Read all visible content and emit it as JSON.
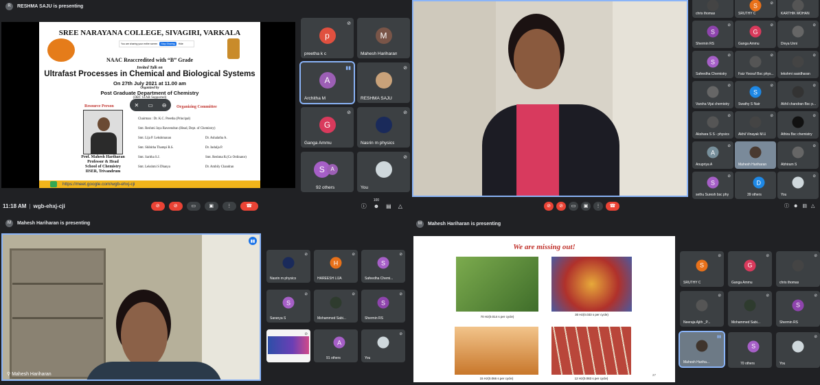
{
  "q1": {
    "presenting": "RESHMA SAJU is presenting",
    "presenter_initial": "R",
    "slide": {
      "college": "SREE NARAYANA COLLEGE, SIVAGIRI, VARKALA",
      "share_notice": "You are sharing your entire screen",
      "share_btn": "Stop Sharing",
      "hide_btn": "Hide",
      "naac": "NAAC Reaccredited with “B” Grade",
      "invited": "Invited Talk on",
      "title": "Ultrafast Processes in Chemical and Biological Systems",
      "date": "On 27th July 2021 at 11.00 am",
      "organized": "Organized by",
      "dept": "Post Graduate Department of Chemistry",
      "star": "(DBT STAR Supported)",
      "resource": "Resource Person",
      "organizing": "Organizing Committee",
      "members": [
        "Chairman : Dr. K.C. Preetha (Principal)",
        "Smt. Reshmi Jaya Raveendran (Head, Dept. of Chemistry)",
        "Smt. Lija P. Lekshmanan",
        "Dr. Ashalatha A.",
        "Smt. Shibitha Thampi R.S.",
        "Dr. Indulja P.",
        "Smt. Saritha S.J.",
        "Smt. Reshma R.(Co Ordinator)",
        "Smt. Lekshmi S Dhanya",
        "Dr. Ambily Chandran"
      ],
      "speaker": [
        "Prof. Mahesh Hariharan",
        "Professor & Head",
        "School of Chemistry",
        "IISER, Trivandrum"
      ],
      "link": "https://meet.google.com/wgb-ehxj-cji"
    },
    "tiles": [
      {
        "name": "preetha k c",
        "initial": "p",
        "color": "#e0503f"
      },
      {
        "name": "Mahesh Hariharan",
        "initial": "M",
        "color": "#795548"
      },
      {
        "name": "Architha M",
        "initial": "A",
        "color": "#9c5fb5"
      },
      {
        "name": "RESHMA SAJU",
        "initial": "",
        "color": "#c9a27a"
      },
      {
        "name": "Ganga Ammu",
        "initial": "G",
        "color": "#d93a5c"
      },
      {
        "name": "Nasrin m physics",
        "initial": "",
        "color": "#1a2a5a"
      },
      {
        "name": "92 others",
        "initial": "S",
        "color": "#a65fc7"
      },
      {
        "name": "You",
        "initial": "",
        "color": "#cfd8dc"
      }
    ],
    "time": "11:18 AM",
    "meeting_code": "wgb-ehxj-cji",
    "participants_count": "100"
  },
  "q2": {
    "tiles": [
      {
        "name": "chris thomas",
        "initial": "",
        "color": "#444"
      },
      {
        "name": "SRUTHY C",
        "initial": "S",
        "color": "#e8711a"
      },
      {
        "name": "KARTHIK MOHAN",
        "initial": "",
        "color": "#555"
      },
      {
        "name": "Shermin RS",
        "initial": "S",
        "color": "#8e44ad"
      },
      {
        "name": "Ganga Ammu",
        "initial": "G",
        "color": "#d93a5c"
      },
      {
        "name": "Divya Unni",
        "initial": "",
        "color": "#666"
      },
      {
        "name": "Safeedha Chemistry",
        "initial": "S",
        "color": "#a65fc7"
      },
      {
        "name": "Faiz Yoosuf Bsc phys...",
        "initial": "",
        "color": "#555"
      },
      {
        "name": "lekshmi sasidharan",
        "initial": "",
        "color": "#444"
      },
      {
        "name": "Varsha Vijai chemistry",
        "initial": "",
        "color": "#666"
      },
      {
        "name": "Swathy S Nair",
        "initial": "S",
        "color": "#1e88e5"
      },
      {
        "name": "Akhil chandran Bsc p...",
        "initial": "",
        "color": "#333"
      },
      {
        "name": "Akshara S S - physics",
        "initial": "",
        "color": "#555"
      },
      {
        "name": "Akhil Vinayak M.U",
        "initial": "",
        "color": "#444"
      },
      {
        "name": "Athira Bsc chemistry",
        "initial": "",
        "color": "#111"
      },
      {
        "name": "Anupriya A",
        "initial": "A",
        "color": "#78909c"
      },
      {
        "name": "Mahesh Hariharan",
        "initial": "",
        "color": "#7a8a9a"
      },
      {
        "name": "Abhiram S",
        "initial": "",
        "color": "#666"
      },
      {
        "name": "sethu Suresh bsc phy",
        "initial": "S",
        "color": "#a65fc7"
      },
      {
        "name": "39 others",
        "initial": "D",
        "color": "#1e88e5"
      },
      {
        "name": "You",
        "initial": "",
        "color": "#cfd8dc"
      }
    ]
  },
  "q3": {
    "presenting": "Mahesh Hariharan is presenting",
    "presenter_initial": "M",
    "main_name": "Mahesh Hariharan",
    "tiles": [
      {
        "name": "Nasrin m physics",
        "initial": "",
        "color": "#1a2a5a"
      },
      {
        "name": "HAREESH LIJA",
        "initial": "H",
        "color": "#e8711a"
      },
      {
        "name": "Safeedha Chemi...",
        "initial": "S",
        "color": "#a65fc7"
      },
      {
        "name": "Saranya S",
        "initial": "S",
        "color": "#a65fc7"
      },
      {
        "name": "Mohammed Sabi...",
        "initial": "",
        "color": "#2e3b2e"
      },
      {
        "name": "Shermin RS",
        "initial": "S",
        "color": "#8e44ad"
      },
      {
        "name": "",
        "initial": "",
        "color": "#f5f5f5"
      },
      {
        "name": "91 others",
        "initial": "A",
        "color": "#a65fc7"
      },
      {
        "name": "You",
        "initial": "",
        "color": "#cfd8dc"
      }
    ]
  },
  "q4": {
    "presenting": "Mahesh Hariharan is presenting",
    "presenter_initial": "M",
    "slide": {
      "title": "We are missing out!",
      "captions": [
        "70 Hz(0.014 s per cycle)",
        "30 Hz(0.033 s per cycle)",
        "15 Hz(0.066 s per cycle)",
        "12 Hz(0.083 s per cycle)"
      ],
      "page": "27"
    },
    "tiles": [
      {
        "name": "SRUTHY C",
        "initial": "S",
        "color": "#e8711a"
      },
      {
        "name": "Ganga Ammu",
        "initial": "G",
        "color": "#d93a5c"
      },
      {
        "name": "chris thomas",
        "initial": "",
        "color": "#444"
      },
      {
        "name": "Neeraja Ajith _P...",
        "initial": "",
        "color": "#555"
      },
      {
        "name": "Mohammed Sabi...",
        "initial": "",
        "color": "#2e3b2e"
      },
      {
        "name": "Shermin RS",
        "initial": "S",
        "color": "#8e44ad"
      },
      {
        "name": "Mahesh Hariha...",
        "initial": "",
        "color": "#7a8a9a"
      },
      {
        "name": "70 others",
        "initial": "S",
        "color": "#a65fc7"
      },
      {
        "name": "You",
        "initial": "",
        "color": "#cfd8dc"
      }
    ]
  }
}
